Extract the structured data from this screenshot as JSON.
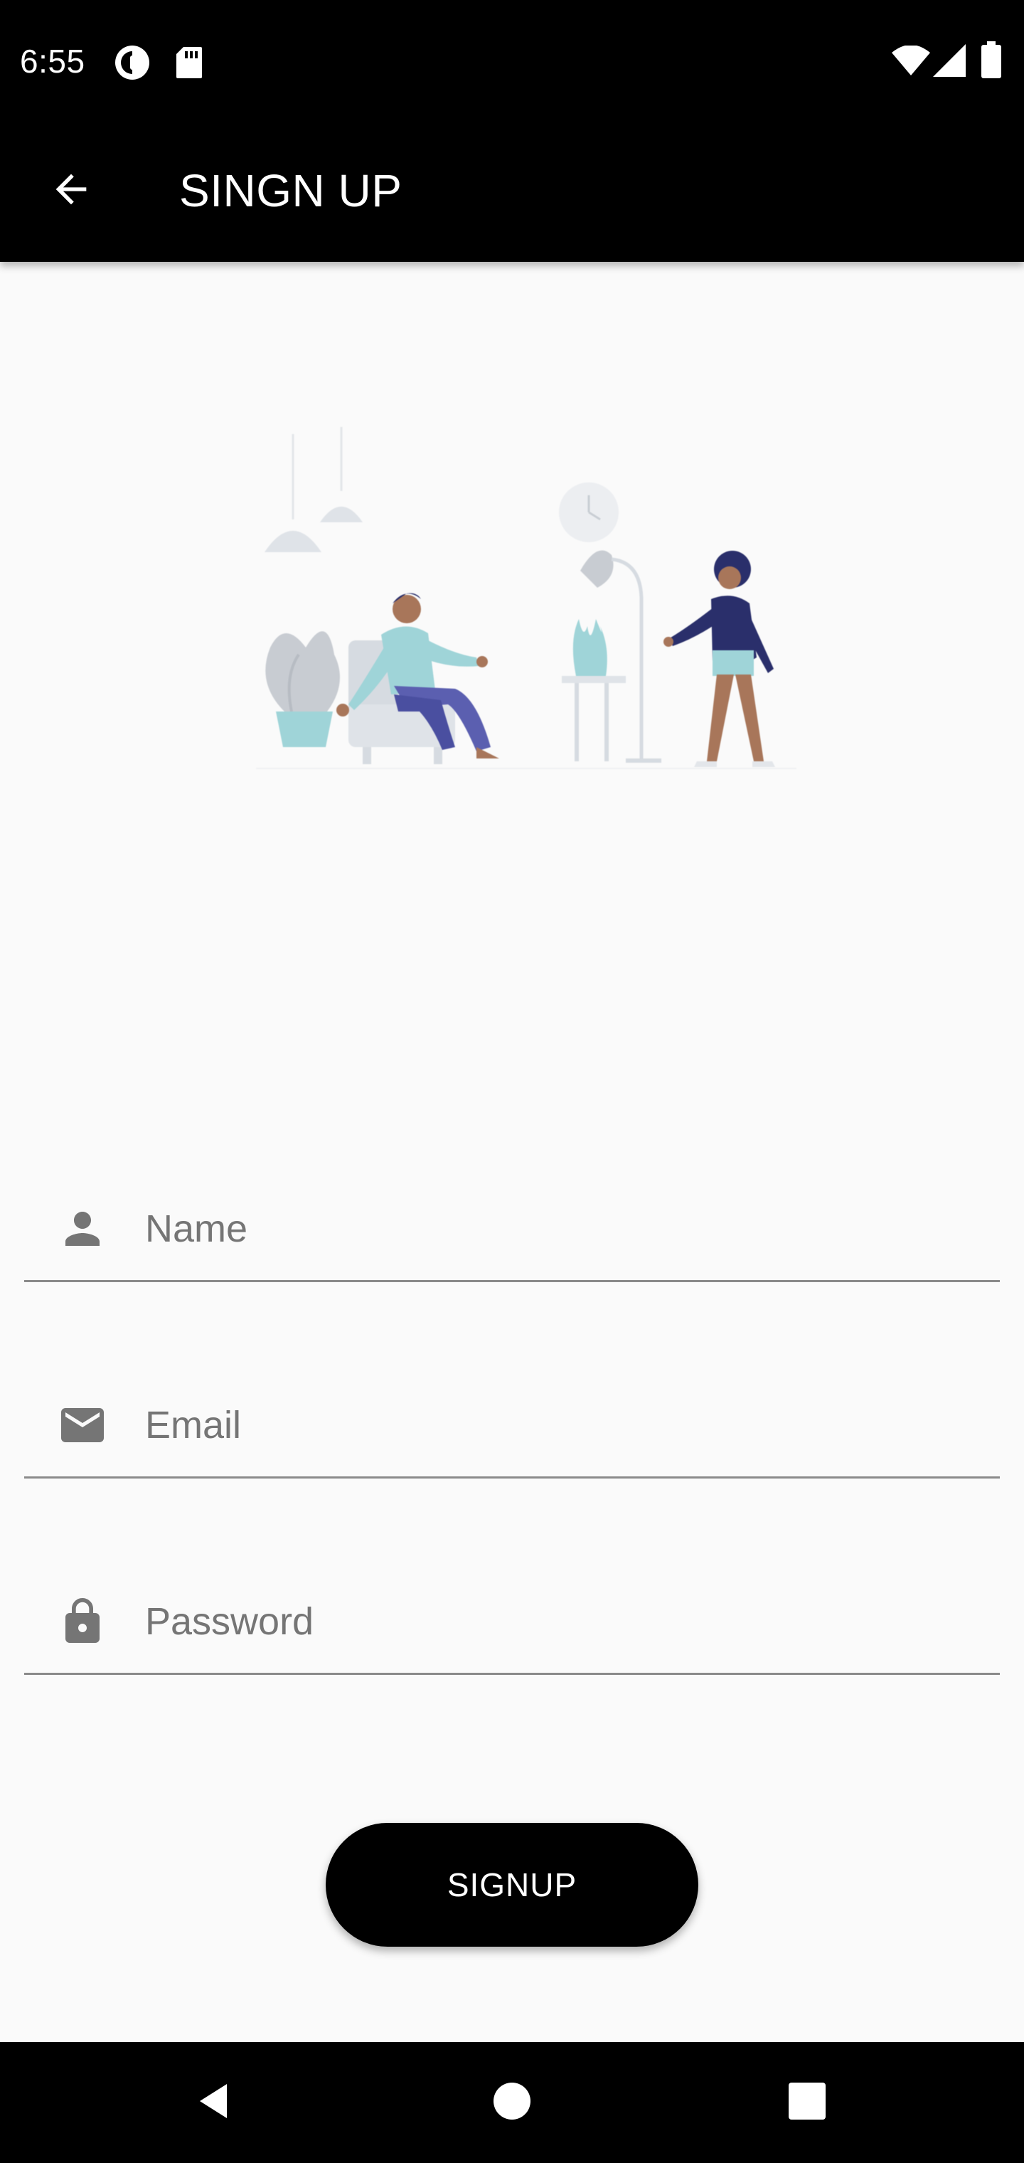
{
  "status_bar": {
    "time": "6:55",
    "icons": [
      "data-saver-icon",
      "sd-card-icon",
      "wifi-icon",
      "cellular-signal-icon",
      "battery-icon"
    ]
  },
  "app_bar": {
    "title": "SINGN UP",
    "back_icon": "arrow-back-icon"
  },
  "illustration": {
    "subject": "two-people-chatting-illustration"
  },
  "form": {
    "name": {
      "placeholder": "Name",
      "value": "",
      "icon": "person-icon"
    },
    "email": {
      "placeholder": "Email",
      "value": "",
      "icon": "mail-icon"
    },
    "password": {
      "placeholder": "Password",
      "value": "",
      "icon": "lock-icon"
    }
  },
  "signup_button": {
    "label": "SIGNUP"
  },
  "nav_bar": {
    "items": [
      "back-triangle-icon",
      "home-circle-icon",
      "recents-square-icon"
    ]
  },
  "colors": {
    "background": "#fafafa",
    "bar": "#000000",
    "field_icon": "#757575",
    "underline": "#8a8a8a",
    "illustration_teal": "#9fd4d8",
    "illustration_navy": "#2a2f6b",
    "illustration_purple": "#5b5fb0",
    "illustration_skin": "#a8765a"
  }
}
